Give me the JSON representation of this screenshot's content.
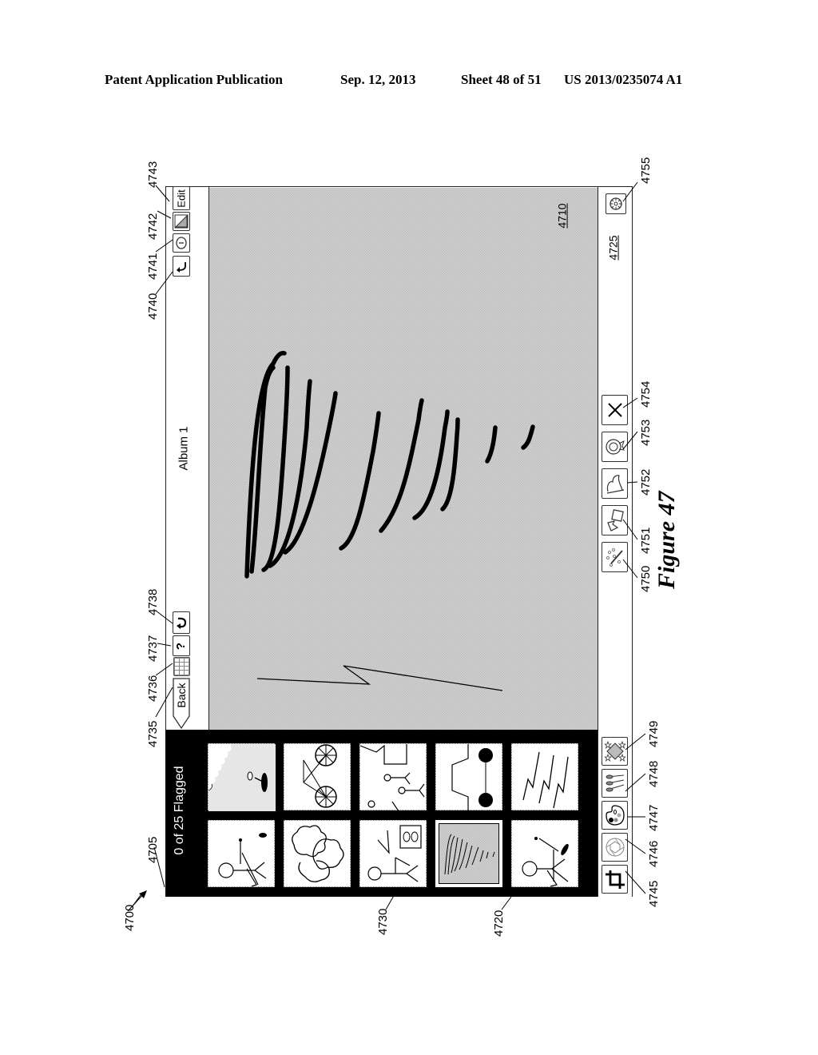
{
  "header": {
    "left": "Patent Application Publication",
    "date": "Sep. 12, 2013",
    "sheet": "Sheet 48 of 51",
    "number": "US 2013/0235074 A1"
  },
  "figure": {
    "caption": "Figure 47",
    "ref_main": "4700"
  },
  "ui": {
    "album_title": "Album 1",
    "flag_status": "0 of 25 Flagged",
    "back_label": "Back",
    "help_label": "?",
    "edit_label": "Edit",
    "canvas_ref": "4710",
    "bottom_bar_ref": "4725",
    "thumbnails": [
      {
        "name": "thumb-person-umbrella-grass",
        "selected": false
      },
      {
        "name": "thumb-bicycle",
        "selected": false
      },
      {
        "name": "thumb-family",
        "selected": false
      },
      {
        "name": "thumb-car",
        "selected": false
      },
      {
        "name": "thumb-zigzags",
        "selected": false
      },
      {
        "name": "thumb-stick-figure-signpost",
        "selected": false
      },
      {
        "name": "thumb-clouds",
        "selected": false
      },
      {
        "name": "thumb-person-frame",
        "selected": false
      },
      {
        "name": "thumb-scribble",
        "selected": true
      },
      {
        "name": "thumb-stick-figure-paddle",
        "selected": false
      }
    ]
  },
  "refs": {
    "r4705": "4705",
    "r4720": "4720",
    "r4730": "4730",
    "r4735": "4735",
    "r4736": "4736",
    "r4737": "4737",
    "r4738": "4738",
    "r4740": "4740",
    "r4741": "4741",
    "r4742": "4742",
    "r4743": "4743",
    "r4745": "4745",
    "r4746": "4746",
    "r4747": "4747",
    "r4748": "4748",
    "r4749": "4749",
    "r4750": "4750",
    "r4751": "4751",
    "r4752": "4752",
    "r4753": "4753",
    "r4754": "4754",
    "r4755": "4755"
  },
  "icons": {
    "share": "share-icon",
    "info": "info-icon",
    "compare": "show-original-icon",
    "grid": "grid-view-icon",
    "undo": "undo-icon",
    "crop": "crop-icon",
    "exposure": "exposure-aperture-icon",
    "color": "color-palette-icon",
    "brushes": "brushes-icon",
    "effects": "effects-icon",
    "auto_enhance": "auto-enhance-wand-icon",
    "rotate": "rotate-icon",
    "flag": "flag-icon",
    "favorite": "favorite-ribbon-icon",
    "reject": "reject-x-icon",
    "settings": "settings-gear-icon"
  }
}
